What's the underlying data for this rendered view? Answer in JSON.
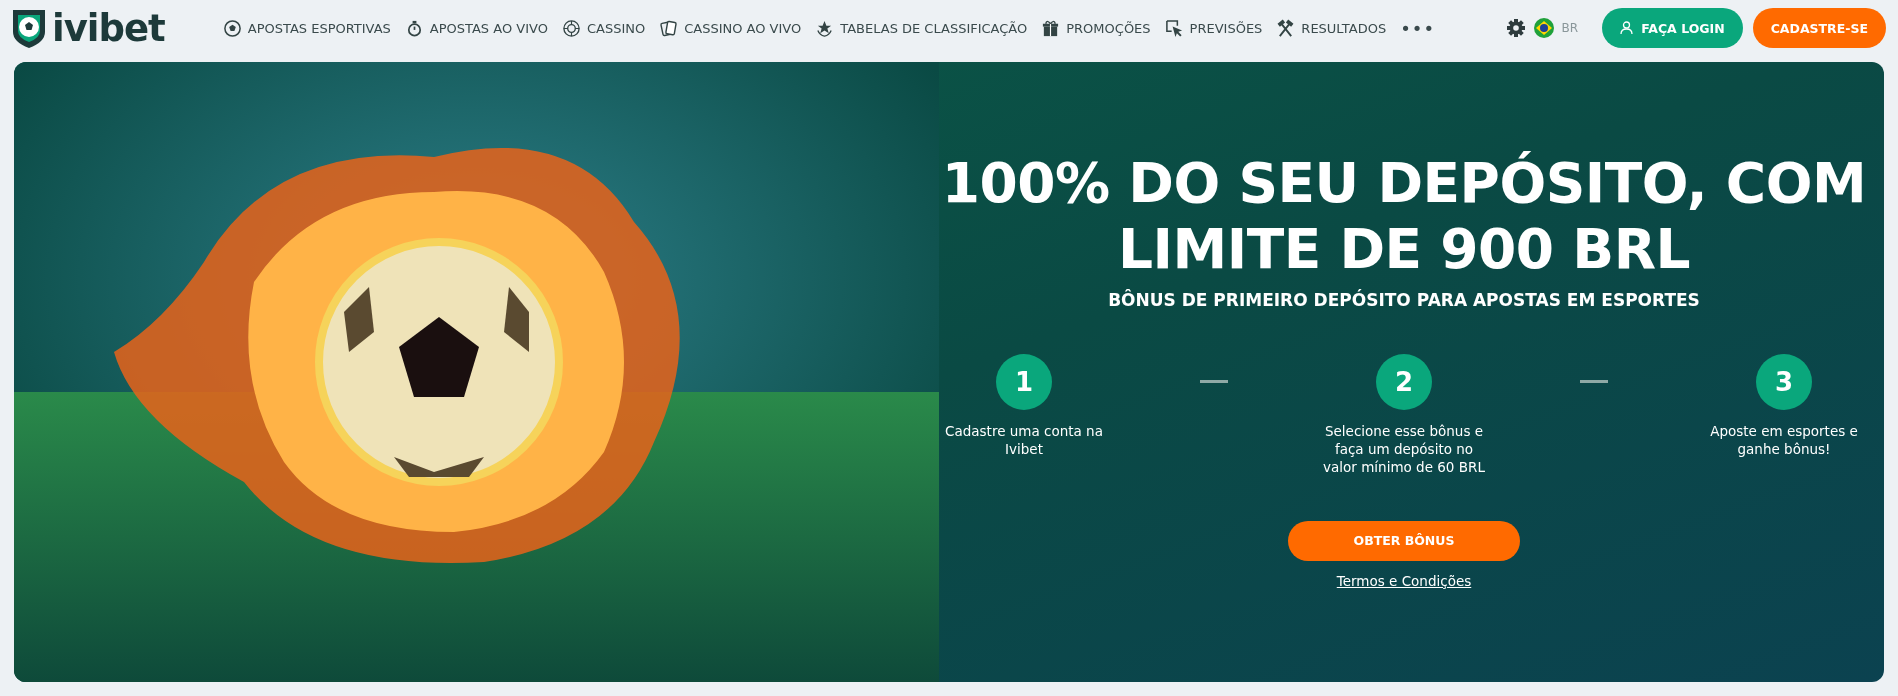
{
  "header": {
    "logo": "ivibet",
    "nav": [
      {
        "label": "APOSTAS ESPORTIVAS"
      },
      {
        "label": "APOSTAS AO VIVO"
      },
      {
        "label": "CASSINO"
      },
      {
        "label": "CASSINO AO VIVO"
      },
      {
        "label": "TABELAS DE CLASSIFICAÇÃO"
      },
      {
        "label": "PROMOÇÕES"
      },
      {
        "label": "PREVISÕES"
      },
      {
        "label": "RESULTADOS"
      }
    ],
    "more": "•••",
    "language": "BR",
    "login": "FAÇA LOGIN",
    "register": "CADASTRE-SE"
  },
  "banner": {
    "title": "100% DO SEU DEPÓSITO, COM LIMITE DE 900 BRL",
    "subtitle": "BÔNUS DE PRIMEIRO DEPÓSITO PARA APOSTAS EM ESPORTES",
    "steps": [
      {
        "number": "1",
        "text": "Cadastre uma conta na Ivibet"
      },
      {
        "number": "2",
        "text": "Selecione esse bônus e faça um depósito no valor mínimo de 60 BRL"
      },
      {
        "number": "3",
        "text": "Aposte em esportes e ganhe bônus!"
      }
    ],
    "cta": "OBTER BÔNUS",
    "terms": "Termos e Condições"
  }
}
